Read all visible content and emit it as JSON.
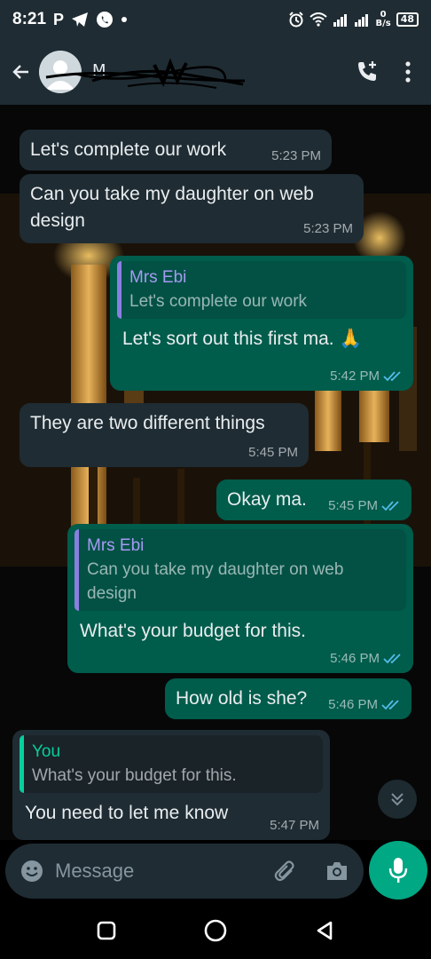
{
  "status_bar": {
    "time": "8:21",
    "left_glyph": "P",
    "net_speed_top": "0",
    "net_speed_unit": "B/s",
    "battery": "48"
  },
  "header": {
    "contact_name": "M"
  },
  "messages": [
    {
      "text": "Let's complete our work",
      "time": "5:23 PM"
    },
    {
      "text": "Can you take my daughter on web design",
      "time": "5:23 PM"
    },
    {
      "quote_author": "Mrs Ebi",
      "quote_text": "Let's complete our work",
      "text": "Let's sort out this first ma. 🙏",
      "time": "5:42 PM"
    },
    {
      "text": "They are two different things",
      "time": "5:45 PM"
    },
    {
      "text": "Okay ma.",
      "time": "5:45 PM"
    },
    {
      "quote_author": "Mrs Ebi",
      "quote_text": "Can you take my daughter on web design",
      "text": "What's your budget for this.",
      "time": "5:46 PM"
    },
    {
      "text": "How old is she?",
      "time": "5:46 PM"
    },
    {
      "quote_author": "You",
      "quote_text": "What's your budget for this.",
      "text": "You need to let me know",
      "time": "5:47 PM"
    }
  ],
  "composer": {
    "placeholder": "Message"
  },
  "colors": {
    "incoming": "#1f2c33",
    "outgoing": "#005c4b",
    "accent": "#00a884",
    "read_ticks": "#53bdeb"
  },
  "icons": [
    "back-arrow-icon",
    "add-call-icon",
    "more-vert-icon",
    "emoji-icon",
    "attach-icon",
    "camera-icon",
    "mic-icon",
    "scroll-down-icon",
    "read-ticks-icon",
    "pray-emoji"
  ]
}
